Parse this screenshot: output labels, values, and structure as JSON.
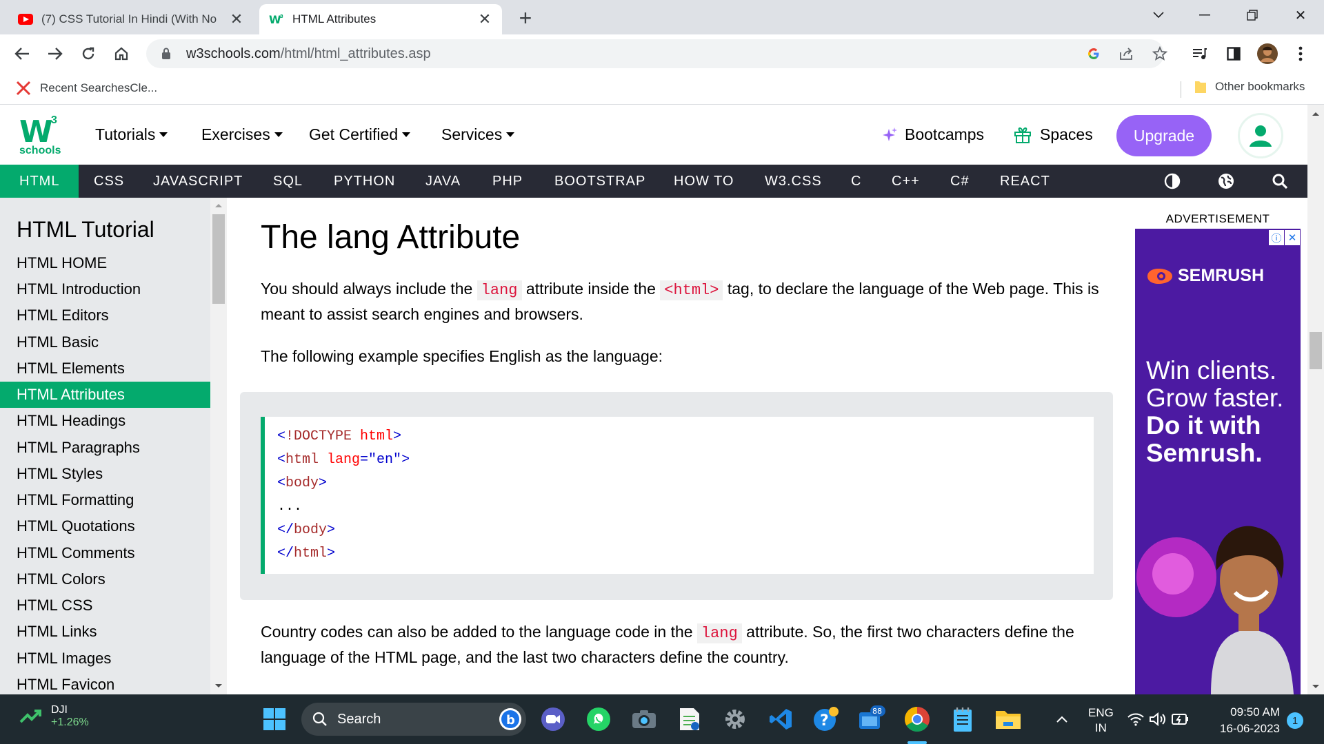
{
  "browser": {
    "tabs": [
      {
        "title": "(7) CSS Tutorial In Hindi (With No",
        "active": false
      },
      {
        "title": "HTML Attributes",
        "active": true
      }
    ],
    "url_host": "w3schools.com",
    "url_path": "/html/html_attributes.asp",
    "bookmarks": {
      "left": "Recent SearchesCle...",
      "right": "Other bookmarks"
    }
  },
  "w3": {
    "logo_top": "W",
    "logo_sup": "3",
    "logo_sub": "schools",
    "topnav": [
      "Tutorials",
      "Exercises",
      "Get Certified",
      "Services"
    ],
    "bootcamps": "Bootcamps",
    "spaces": "Spaces",
    "upgrade": "Upgrade",
    "subnav": [
      "HTML",
      "CSS",
      "JAVASCRIPT",
      "SQL",
      "PYTHON",
      "JAVA",
      "PHP",
      "BOOTSTRAP",
      "HOW TO",
      "W3.CSS",
      "C",
      "C++",
      "C#",
      "REACT"
    ]
  },
  "sidebar": {
    "title": "HTML Tutorial",
    "items": [
      "HTML HOME",
      "HTML Introduction",
      "HTML Editors",
      "HTML Basic",
      "HTML Elements",
      "HTML Attributes",
      "HTML Headings",
      "HTML Paragraphs",
      "HTML Styles",
      "HTML Formatting",
      "HTML Quotations",
      "HTML Comments",
      "HTML Colors",
      "HTML CSS",
      "HTML Links",
      "HTML Images",
      "HTML Favicon"
    ],
    "active_index": 5
  },
  "main": {
    "heading": "The lang Attribute",
    "p1_a": "You should always include the ",
    "p1_code1": "lang",
    "p1_b": " attribute inside the ",
    "p1_code2": "<html>",
    "p1_c": " tag, to declare the language of the Web page. This is meant to assist search engines and browsers.",
    "p2": "The following example specifies English as the language:",
    "code": {
      "l1_open": "<",
      "l1_name": "!DOCTYPE",
      "l1_attr": " html",
      "l1_close": ">",
      "l2_open": "<",
      "l2_name": "html",
      "l2_attr": " lang",
      "l2_eq": "=\"en\"",
      "l2_close": ">",
      "l3_open": "<",
      "l3_name": "body",
      "l3_close": ">",
      "l4": "...",
      "l5_open": "</",
      "l5_name": "body",
      "l5_close": ">",
      "l6_open": "</",
      "l6_name": "html",
      "l6_close": ">"
    },
    "p3_a": "Country codes can also be added to the language code in the ",
    "p3_code": "lang",
    "p3_b": " attribute. So, the first two characters define the language of the HTML page, and the last two characters define the country."
  },
  "ad": {
    "label": "ADVERTISEMENT",
    "brand": "SEMRUSH",
    "line1": "Win clients.",
    "line2": "Grow faster.",
    "line3": "Do it with",
    "line4": "Semrush."
  },
  "taskbar": {
    "stock_name": "DJI",
    "stock_change": "+1.26%",
    "search": "Search",
    "badge": "88",
    "lang1": "ENG",
    "lang2": "IN",
    "time": "09:50 AM",
    "date": "16-06-2023",
    "notif": "1"
  },
  "colors": {
    "w3_green": "#04aa6d",
    "upgrade_purple": "#9763f6",
    "subnav_dark": "#282a35",
    "code_red": "#dc143c"
  }
}
